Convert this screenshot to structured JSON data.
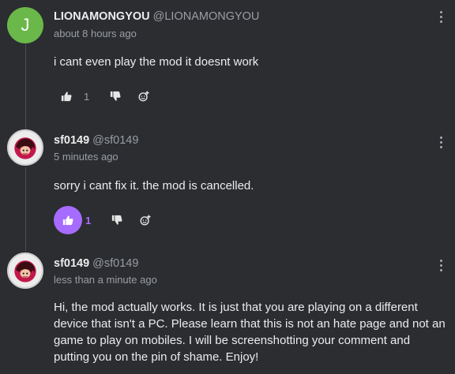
{
  "comments": [
    {
      "avatar_letter": "J",
      "author": "LIONAMONGYOU",
      "handle": "@LIONAMONGYOU",
      "time": "about 8 hours ago",
      "text": "i cant even play the mod it doesnt work",
      "likes": "1",
      "liked": false
    },
    {
      "author": "sf0149",
      "handle": "@sf0149",
      "time": "5 minutes ago",
      "text": "sorry i cant fix it. the mod is cancelled.",
      "likes": "1",
      "liked": true
    },
    {
      "author": "sf0149",
      "handle": "@sf0149",
      "time": "less than a minute ago",
      "text": "Hi, the mod actually works. It is just that you are playing on a different device that isn't a PC. Please learn that this is not an hate page and not an game to play on mobiles. I will be screenshotting your comment and putting you on the pin of shame. Enjoy!"
    }
  ],
  "icons": {
    "like": "thumbs-up-icon",
    "dislike": "thumbs-down-icon",
    "react": "add-reaction-icon",
    "more": "more-vertical-icon"
  },
  "colors": {
    "background": "#2b2d31",
    "accent": "#a66bff",
    "avatar_green": "#6bb84a"
  }
}
